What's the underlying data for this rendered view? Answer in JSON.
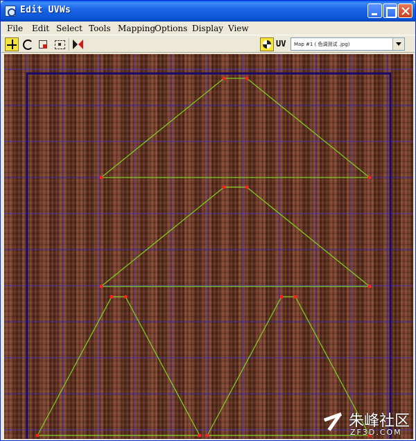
{
  "window": {
    "title": "Edit UVWs",
    "icon": "app-icon"
  },
  "menu": {
    "items": [
      {
        "label": "File"
      },
      {
        "label": "Edit"
      },
      {
        "label": "Select"
      },
      {
        "label": "Tools"
      },
      {
        "label": "Mapping"
      },
      {
        "label": "Options"
      },
      {
        "label": "Display"
      },
      {
        "label": "View"
      }
    ]
  },
  "toolbar": {
    "tools": [
      "move-icon",
      "rotate-icon",
      "scale-icon",
      "freeform-icon",
      "mirror-icon"
    ],
    "show_map_icon": "checker-icon",
    "uv_label": "UV",
    "map_select_value": "Map #1 ( 色调测试 .jpg)"
  },
  "viewport": {
    "grid_color": "#3a2cc8",
    "uv_edge_color": "#7ed321",
    "vertex_color": "#ff2020",
    "frame_color": "#1a0a6a"
  },
  "watermark": {
    "cn": "朱峰社区",
    "en": "ZF3D.COM"
  }
}
